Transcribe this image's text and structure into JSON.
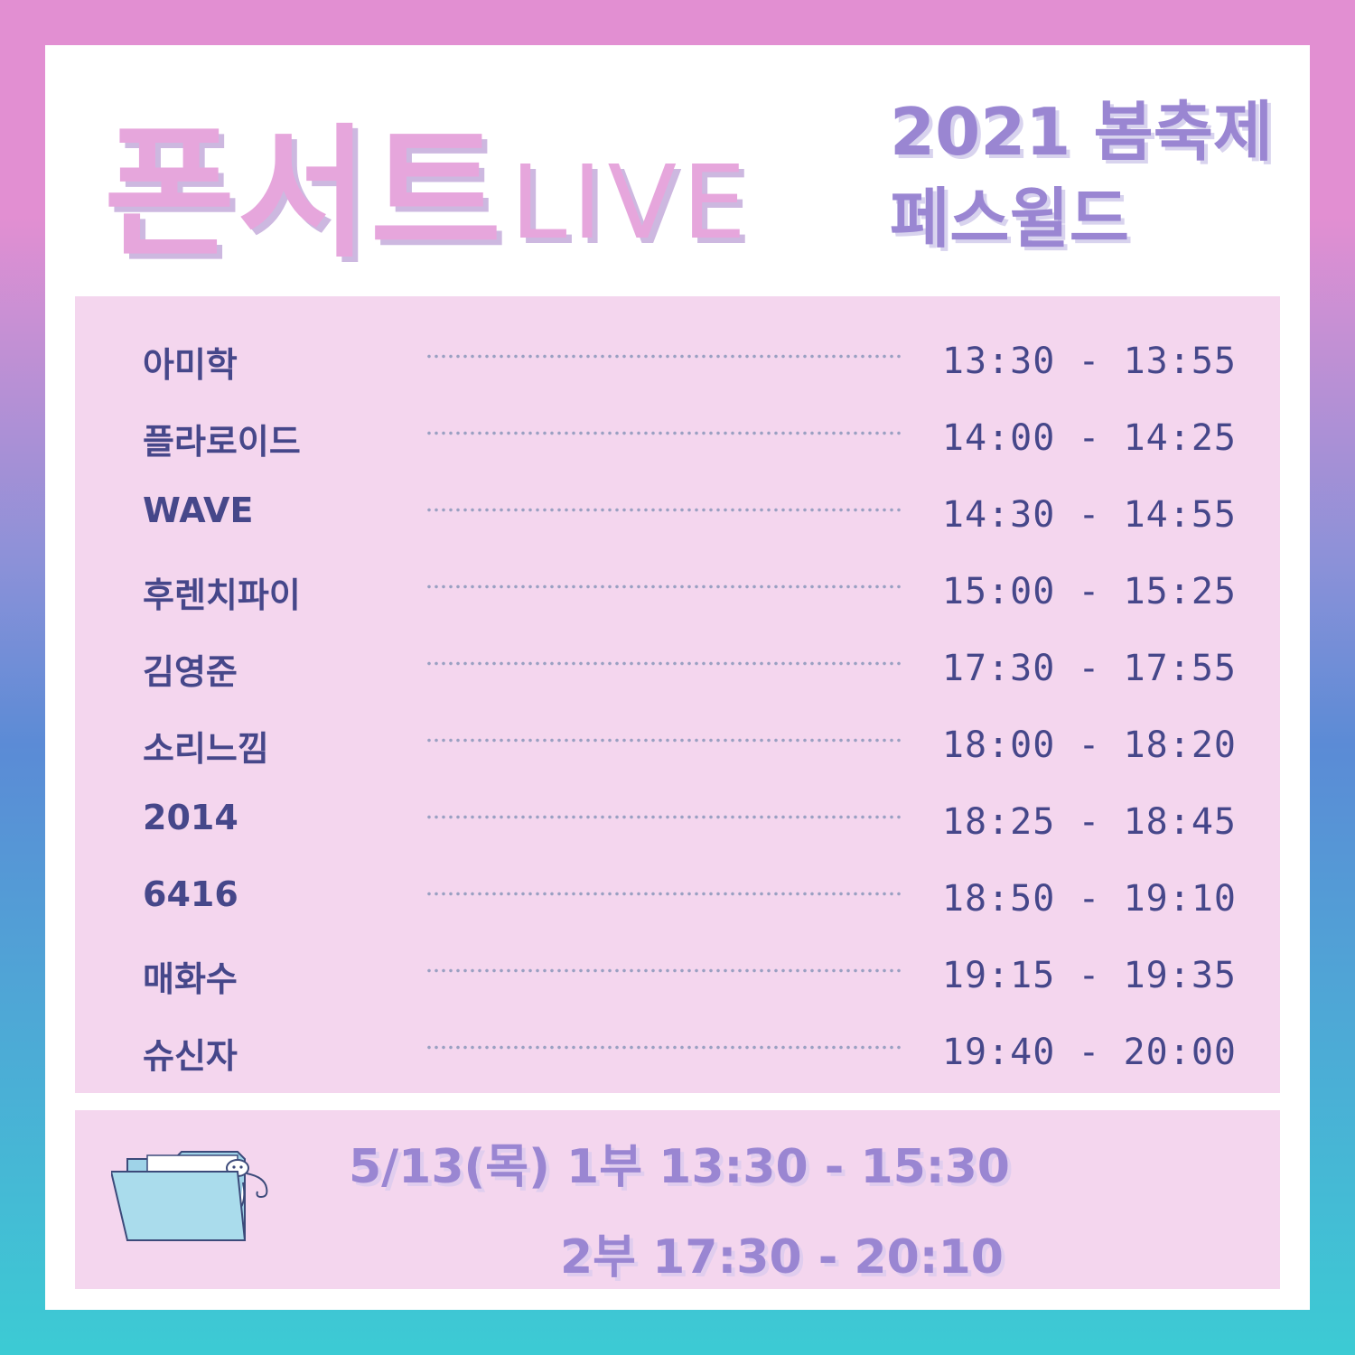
{
  "header": {
    "title_ko": "폰서트",
    "title_en": "LIVE",
    "subtitle_line1": "2021 봄축제",
    "subtitle_line2": "페스윌드"
  },
  "schedule": [
    {
      "name": "아미학",
      "time": "13:30 - 13:55"
    },
    {
      "name": "플라로이드",
      "time": "14:00 - 14:25"
    },
    {
      "name": "WAVE",
      "time": "14:30 - 14:55"
    },
    {
      "name": "후렌치파이",
      "time": "15:00 - 15:25"
    },
    {
      "name": "김영준",
      "time": "17:30 - 17:55"
    },
    {
      "name": "소리느낌",
      "time": "18:00 - 18:20"
    },
    {
      "name": "2014",
      "time": "18:25 - 18:45"
    },
    {
      "name": "6416",
      "time": "18:50 - 19:10"
    },
    {
      "name": "매화수",
      "time": "19:15 - 19:35"
    },
    {
      "name": "슈신자",
      "time": "19:40 - 20:00"
    }
  ],
  "footer": {
    "line1": "5/13(목) 1부 13:30 - 15:30",
    "line2": "2부 17:30 - 20:10"
  },
  "icons": {
    "folder": "folder-icon"
  },
  "colors": {
    "title_pink": "#e6a6dc",
    "subtitle_purple": "#9a86d2",
    "panel_pink": "#f4d6ee",
    "text_navy": "#46478a"
  }
}
